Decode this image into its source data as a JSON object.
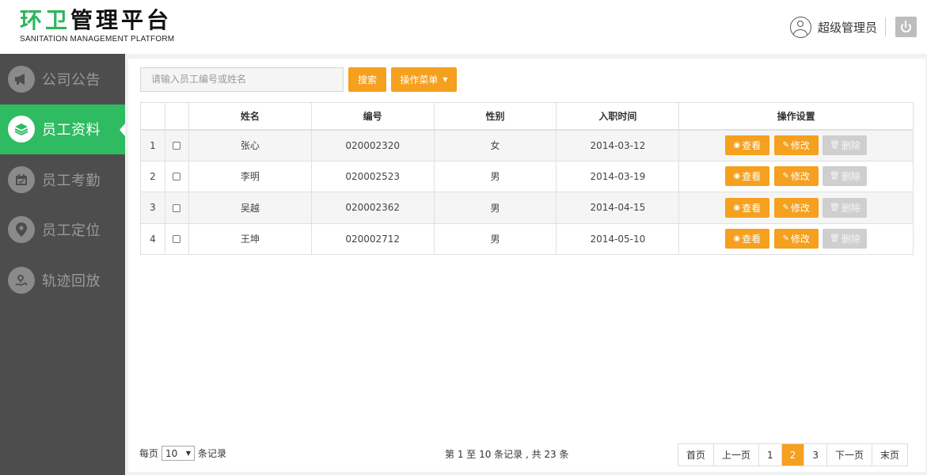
{
  "header": {
    "logo_part1": "环卫",
    "logo_part2": "管理平台",
    "logo_en": "SANITATION MANAGEMENT PLATFORM",
    "user_name": "超级管理员"
  },
  "sidebar": {
    "items": [
      {
        "label": "公司公告",
        "icon": "megaphone-icon",
        "active": false
      },
      {
        "label": "员工资料",
        "icon": "stack-icon",
        "active": true
      },
      {
        "label": "员工考勤",
        "icon": "calendar-icon",
        "active": false
      },
      {
        "label": "员工定位",
        "icon": "location-pin-icon",
        "active": false
      },
      {
        "label": "轨迹回放",
        "icon": "route-icon",
        "active": false
      }
    ]
  },
  "toolbar": {
    "search_placeholder": "请输入员工编号或姓名",
    "search_label": "搜索",
    "menu_label": "操作菜单"
  },
  "table": {
    "headers": [
      "",
      "",
      "姓名",
      "编号",
      "性别",
      "入职时间",
      "操作设置"
    ],
    "rows": [
      {
        "index": "1",
        "name": "张心",
        "id": "020002320",
        "gender": "女",
        "date": "2014-03-12"
      },
      {
        "index": "2",
        "name": "李明",
        "id": "020002523",
        "gender": "男",
        "date": "2014-03-19"
      },
      {
        "index": "3",
        "name": "吴越",
        "id": "020002362",
        "gender": "男",
        "date": "2014-04-15"
      },
      {
        "index": "4",
        "name": "王坤",
        "id": "020002712",
        "gender": "男",
        "date": "2014-05-10"
      }
    ],
    "actions": {
      "view": "查看",
      "edit": "修改",
      "delete": "删除"
    }
  },
  "footer": {
    "per_page_prefix": "每页",
    "per_page_value": "10",
    "per_page_suffix": "条记录",
    "record_info": "第 1 至 10 条记录 , 共 23 条",
    "pager": {
      "first": "首页",
      "prev": "上一页",
      "pages": [
        "1",
        "2",
        "3"
      ],
      "current": "2",
      "next": "下一页",
      "last": "末页"
    }
  },
  "colors": {
    "brand_green": "#2ebb61",
    "accent_orange": "#f5a01e",
    "sidebar_bg": "#4d4d4d"
  }
}
